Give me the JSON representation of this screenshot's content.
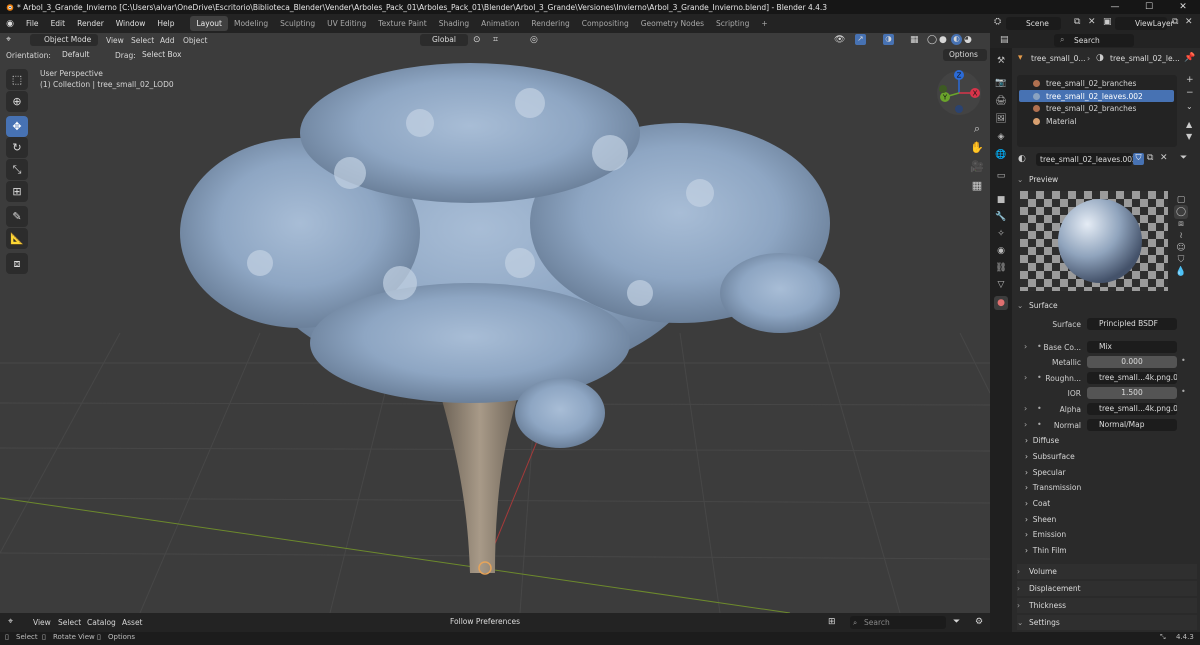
{
  "window": {
    "title": "* Arbol_3_Grande_Invierno [C:\\Users\\alvar\\OneDrive\\Escritorio\\Biblioteca_Blender\\Vender\\Arboles_Pack_01\\Arboles_Pack_01\\Blender\\Arbol_3_Grande\\Versiones\\Invierno\\Arbol_3_Grande_Invierno.blend] - Blender 4.4.3",
    "minimize": "—",
    "maximize": "☐",
    "close": "✕"
  },
  "menu": [
    "File",
    "Edit",
    "Render",
    "Window",
    "Help"
  ],
  "workspaces": [
    "Layout",
    "Modeling",
    "Sculpting",
    "UV Editing",
    "Texture Paint",
    "Shading",
    "Animation",
    "Rendering",
    "Compositing",
    "Geometry Nodes",
    "Scripting",
    "+"
  ],
  "scene": {
    "name": "Scene",
    "view_layer": "ViewLayer"
  },
  "viewport": {
    "mode": "Object Mode",
    "menus": [
      "View",
      "Select",
      "Add",
      "Object"
    ],
    "transform": "Global",
    "orientation_label": "Orientation:",
    "orientation_value": "Default",
    "drag_label": "Drag:",
    "drag_value": "Select Box",
    "options": "Options",
    "perspective": "User Perspective",
    "collection_info": "(1) Collection | tree_small_02_LOD0",
    "gizmo": {
      "x": "X",
      "y": "Y",
      "z": "Z"
    }
  },
  "asset_bar": {
    "menus": [
      "View",
      "Select",
      "Catalog",
      "Asset"
    ],
    "sort": "Follow Preferences",
    "search_placeholder": "Search"
  },
  "status": {
    "select": "Select",
    "rotate": "Rotate View",
    "options": "Options",
    "version": "4.4.3"
  },
  "properties": {
    "search_placeholder": "Search",
    "object_name": "tree_small_0...",
    "material_name_short": "tree_small_02_le...",
    "slots": [
      {
        "label": "tree_small_02_branches",
        "color": "#b07050"
      },
      {
        "label": "tree_small_02_leaves.002",
        "color": "#8aa2c0"
      },
      {
        "label": "tree_small_02_branches",
        "color": "#b07050"
      },
      {
        "label": "Material",
        "color": "#d8a070"
      }
    ],
    "active_material": "tree_small_02_leaves.002",
    "preview_label": "Preview",
    "surface_label": "Surface",
    "surface": {
      "label": "Surface",
      "value": "Principled BSDF"
    },
    "inputs": [
      {
        "label": "Base Co...",
        "value": "Mix",
        "socket": "#c7c729",
        "expand": true
      },
      {
        "label": "Metallic",
        "value": "0.000",
        "socket": "#a1a1a1",
        "numeric": true
      },
      {
        "label": "Roughn...",
        "value": "tree_small...4k.png.001",
        "socket": "#a1a1a1",
        "expand": true
      },
      {
        "label": "IOR",
        "value": "1.500",
        "socket": "#a1a1a1",
        "numeric": true
      },
      {
        "label": "Alpha",
        "value": "tree_small...4k.png.001",
        "socket": "#a1a1a1",
        "expand": true
      },
      {
        "label": "Normal",
        "value": "Normal/Map",
        "socket": "#6363c7",
        "expand": true
      }
    ],
    "subsections": [
      "Diffuse",
      "Subsurface",
      "Specular",
      "Transmission",
      "Coat",
      "Sheen",
      "Emission",
      "Thin Film"
    ],
    "panels": [
      "Volume",
      "Displacement",
      "Thickness",
      "Settings"
    ]
  },
  "colors": {
    "accent": "#4772b3",
    "viewport_bg": "#3c3c3c",
    "panel_bg": "#2a2a2a"
  }
}
